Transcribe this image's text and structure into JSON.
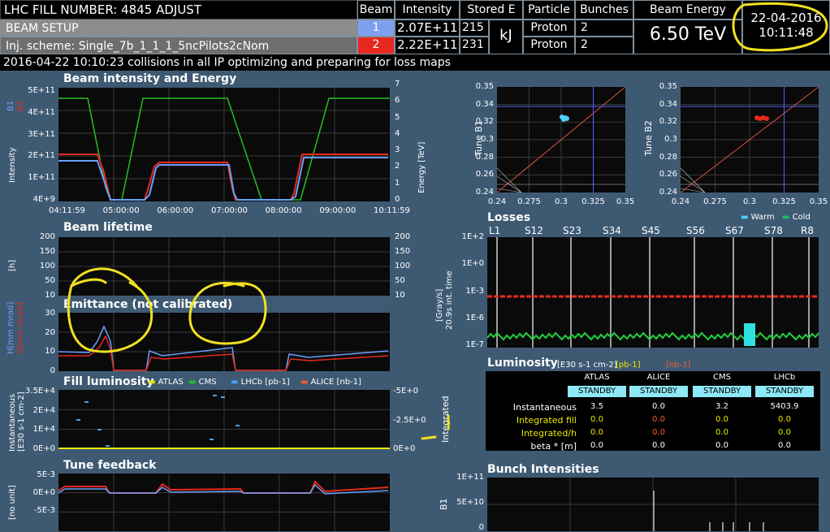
{
  "header": {
    "fill_label": "LHC FILL NUMBER:",
    "fill_number": "4845",
    "mode": "ADJUST",
    "beam_setup": "BEAM SETUP",
    "inj_scheme": "Inj. scheme: Single_7b_1_1_1_5ncPilots2cNom",
    "col_beam": "Beam",
    "col_intensity": "Intensity",
    "col_stored": "Stored E",
    "col_particle": "Particle",
    "col_bunches": "Bunches",
    "col_energy": "Beam Energy",
    "beam1": {
      "num": "1",
      "intensity": "2.07E+11",
      "stored": "215",
      "particle": "Proton",
      "bunches": "2"
    },
    "beam2": {
      "num": "2",
      "intensity": "2.22E+11",
      "stored": "231",
      "particle": "Proton",
      "bunches": "2"
    },
    "stored_unit": "kJ",
    "energy": "6.50 TeV",
    "date": "22-04-2016",
    "time": "10:11:48",
    "status": "2016-04-22  10:10:23  collisions in all IP optimizing and preparing for loss maps"
  },
  "intensity_panel": {
    "title": "Beam intensity and Energy",
    "y_ticks": [
      "5E+11",
      "4E+11",
      "3E+11",
      "2E+11",
      "1E+11",
      "4E+9"
    ],
    "y2_ticks": [
      "7",
      "6",
      "5",
      "4",
      "3",
      "2",
      "1",
      "0"
    ],
    "x_ticks": [
      "04:11:59",
      "05:00:00",
      "06:00:00",
      "07:00:00",
      "08:00:00",
      "09:00:00",
      "10:11:59"
    ],
    "ylabel": "Intensity",
    "y2label": "Energy [TeV]",
    "legend_b1": "B1",
    "legend_b2": "B2"
  },
  "lifetime_panel": {
    "title": "Beam lifetime",
    "y_ticks": [
      "200",
      "150",
      "100",
      "50",
      "10"
    ],
    "y2_ticks": [
      "200",
      "150",
      "100",
      "50",
      "10"
    ],
    "ylabel": "[h]"
  },
  "emittance_panel": {
    "title": "Emittance (not calibrated)",
    "y_ticks": [
      "30",
      "20",
      "10",
      "0"
    ],
    "ylabel_h": "H[mm mrad]",
    "ylabel_v": "V[mm mrad]"
  },
  "fill_lumi_panel": {
    "title": "Fill luminosity",
    "legend": [
      {
        "name": "ATLAS",
        "color": "#e8e800"
      },
      {
        "name": "CMS",
        "color": "#22c022"
      },
      {
        "name": "LHCb  [pb-1]",
        "color": "#4aa0f0"
      },
      {
        "name": "ALICE  [nb-1]",
        "color": "#f06030"
      }
    ],
    "y_ticks": [
      "3.5E+4",
      "2E+4",
      "1E+4",
      "0E+0"
    ],
    "y2_ticks": [
      "-5E+0",
      "-2.5E+0",
      "0E+0"
    ],
    "ylabel": "Instantaneous [E30 s-1 cm-2]",
    "y2label": "Integrated"
  },
  "tune_fb_panel": {
    "title": "Tune feedback",
    "y_ticks": [
      "5E-3",
      "0E+0",
      "-5E-3"
    ],
    "ylabel": "[no unit]"
  },
  "tune_b1": {
    "ylabel": "Tune B1",
    "y_ticks": [
      "0.35",
      "0.34",
      "0.32",
      "0.3",
      "0.28",
      "0.26",
      "0.24"
    ],
    "x_ticks": [
      "0.24",
      "0.275",
      "0.3",
      "0.325",
      "0.35"
    ]
  },
  "tune_b2": {
    "ylabel": "Tune B2",
    "y_ticks": [
      "0.35",
      "0.34",
      "0.32",
      "0.3",
      "0.28",
      "0.26",
      "0.24"
    ],
    "x_ticks": [
      "0.24",
      "0.275",
      "0.3",
      "0.325",
      "0.35"
    ],
    "legend_warm": "Warm",
    "legend_cold": "Cold"
  },
  "losses_panel": {
    "title": "Losses",
    "sectors": [
      "L1",
      "S12",
      "S23",
      "S34",
      "S45",
      "S56",
      "S67",
      "S78",
      "R8"
    ],
    "y_ticks": [
      "1E+2",
      "1E+0",
      "1E-3",
      "1E-6",
      "1E-7"
    ],
    "ylabel": "[Gray/s]",
    "ylabel2": "20.9s int. time"
  },
  "lumi_table": {
    "title": "Luminosity",
    "units": "[E30 s-1 cm-2]",
    "unit_pb": "[pb-1]",
    "unit_nb": "[nb-1]",
    "columns": [
      "ATLAS",
      "ALICE",
      "CMS",
      "LHCb"
    ],
    "status": [
      "STANDBY",
      "STANDBY",
      "STANDBY",
      "STANDBY"
    ],
    "rows": [
      {
        "label": "Instantaneous",
        "values": [
          "3.5",
          "0.0",
          "3.2",
          "5403.9"
        ]
      },
      {
        "label": "Integrated fill",
        "values": [
          "0.0",
          "0.0",
          "0.0",
          "0.0"
        ]
      },
      {
        "label": "Integrated/h",
        "values": [
          "0.0",
          "0.0",
          "0.0",
          "0.0"
        ]
      },
      {
        "label": "beta * [m]",
        "values": [
          "0.0",
          "0.0",
          "0.0",
          "0.0"
        ]
      }
    ]
  },
  "bunch_panel": {
    "title": "Bunch Intensities",
    "ylabel": "B1",
    "y_ticks": [
      "1E+11",
      "5E+10",
      "0"
    ]
  },
  "colors": {
    "beam1": "#6aa0ff",
    "beam2": "#e8281e",
    "energy": "#22c022",
    "annotation": "#f0e020"
  }
}
